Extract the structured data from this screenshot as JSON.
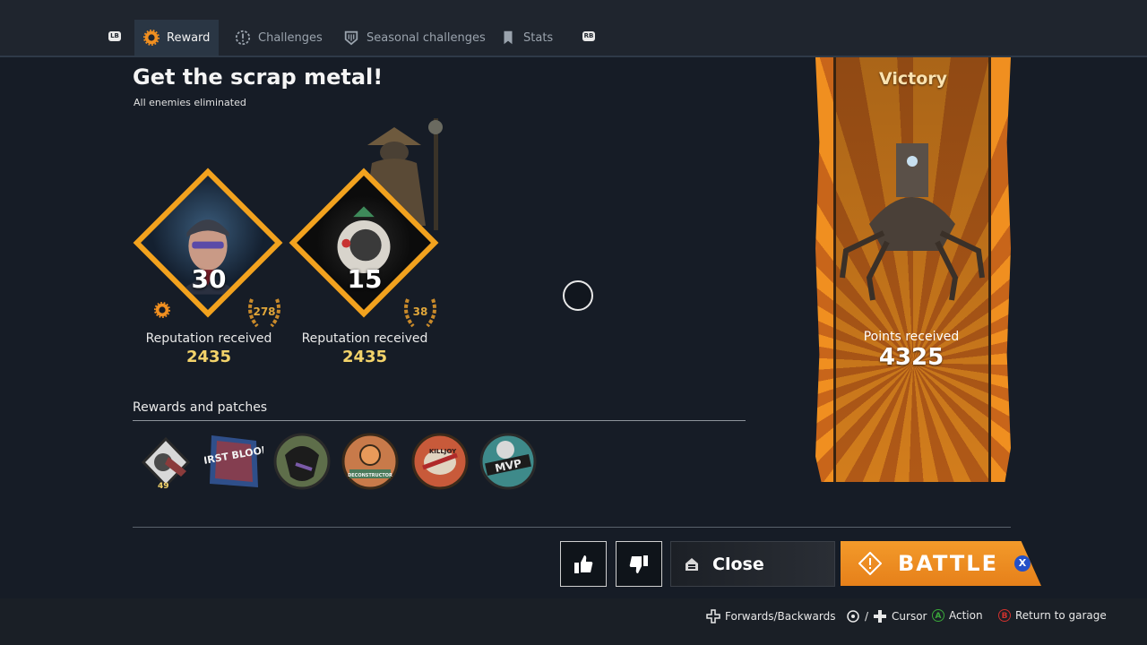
{
  "nav": {
    "lb": "LB",
    "rb": "RB",
    "tabs": [
      {
        "label": "Reward",
        "icon": "reward-gear-icon",
        "active": true
      },
      {
        "label": "Challenges",
        "icon": "challenges-icon",
        "active": false
      },
      {
        "label": "Seasonal challenges",
        "icon": "seasonal-challenges-icon",
        "active": false
      },
      {
        "label": "Stats",
        "icon": "stats-icon",
        "active": false
      }
    ]
  },
  "header": {
    "title": "Get the scrap metal!",
    "subtitle": "All enemies eliminated"
  },
  "characters": [
    {
      "portrait": "engineer-portrait",
      "level": "30",
      "rank": "278",
      "label": "Reputation received",
      "value": "2435"
    },
    {
      "portrait": "faction-emblem-portrait",
      "level": "15",
      "rank": "38",
      "label": "Reputation received",
      "value": "2435"
    }
  ],
  "rewards": {
    "title": "Rewards and patches",
    "items": [
      {
        "name": "reward-crate",
        "count": "49"
      },
      {
        "name": "patch-first-blood",
        "text": "FIRST BLOOD"
      },
      {
        "name": "patch-dark-beast"
      },
      {
        "name": "patch-deconstructor",
        "text": "DECONSTRUCTOR"
      },
      {
        "name": "patch-killjoy",
        "text": "KILLJOY"
      },
      {
        "name": "patch-mvp",
        "text": "MVP"
      }
    ]
  },
  "banner": {
    "title": "Victory",
    "points_label": "Points received",
    "points_value": "4325",
    "colors": {
      "orange": "#f08f20",
      "dark_orange": "#c8651a"
    }
  },
  "actions": {
    "close_label": "Close",
    "battle_label": "BATTLE",
    "battle_button_glyph": "X"
  },
  "footer": {
    "hints": [
      {
        "label": "Forwards/Backwards",
        "icon": "dpad-icon"
      },
      {
        "label": "Cursor",
        "icon": "stick-dpad-icon",
        "separator": "/"
      },
      {
        "label": "Action",
        "button": "A",
        "color": "#3aa83a"
      },
      {
        "label": "Return to garage",
        "button": "B",
        "color": "#d0312d"
      }
    ]
  }
}
